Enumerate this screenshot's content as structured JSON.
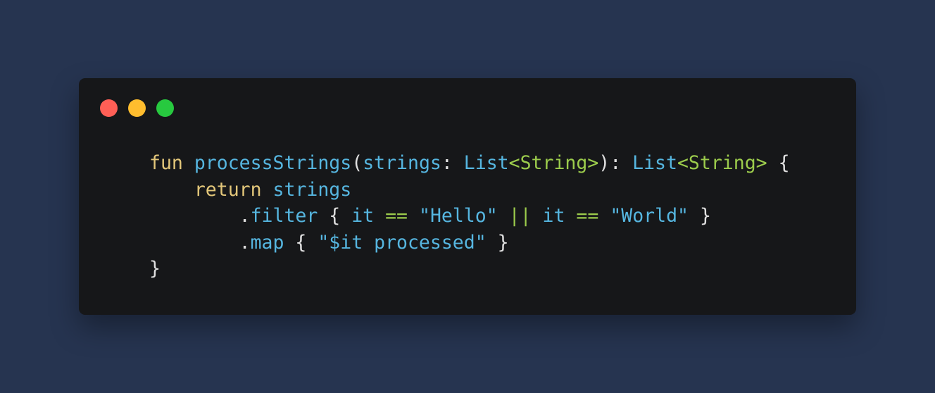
{
  "window": {
    "controls": {
      "close_color": "#ff5f56",
      "minimize_color": "#ffbd2e",
      "zoom_color": "#27c93f"
    }
  },
  "code": {
    "language": "kotlin",
    "lines": [
      [
        {
          "text": "fun",
          "kind": "keyword"
        },
        {
          "text": " ",
          "kind": "punct"
        },
        {
          "text": "processStrings",
          "kind": "fn"
        },
        {
          "text": "(",
          "kind": "punct"
        },
        {
          "text": "strings",
          "kind": "param"
        },
        {
          "text": ": ",
          "kind": "punct"
        },
        {
          "text": "List",
          "kind": "type"
        },
        {
          "text": "<String>",
          "kind": "generic"
        },
        {
          "text": "): ",
          "kind": "punct"
        },
        {
          "text": "List",
          "kind": "type"
        },
        {
          "text": "<String>",
          "kind": "generic"
        },
        {
          "text": " {",
          "kind": "punct"
        }
      ],
      [
        {
          "text": "    ",
          "kind": "punct"
        },
        {
          "text": "return",
          "kind": "keyword"
        },
        {
          "text": " ",
          "kind": "punct"
        },
        {
          "text": "strings",
          "kind": "param"
        }
      ],
      [
        {
          "text": "        .",
          "kind": "punct"
        },
        {
          "text": "filter",
          "kind": "fn"
        },
        {
          "text": " { ",
          "kind": "punct"
        },
        {
          "text": "it",
          "kind": "param"
        },
        {
          "text": " ",
          "kind": "punct"
        },
        {
          "text": "==",
          "kind": "op"
        },
        {
          "text": " ",
          "kind": "punct"
        },
        {
          "text": "\"Hello\"",
          "kind": "string"
        },
        {
          "text": " ",
          "kind": "punct"
        },
        {
          "text": "||",
          "kind": "op"
        },
        {
          "text": " ",
          "kind": "punct"
        },
        {
          "text": "it",
          "kind": "param"
        },
        {
          "text": " ",
          "kind": "punct"
        },
        {
          "text": "==",
          "kind": "op"
        },
        {
          "text": " ",
          "kind": "punct"
        },
        {
          "text": "\"World\"",
          "kind": "string"
        },
        {
          "text": " }",
          "kind": "punct"
        }
      ],
      [
        {
          "text": "        .",
          "kind": "punct"
        },
        {
          "text": "map",
          "kind": "fn"
        },
        {
          "text": " { ",
          "kind": "punct"
        },
        {
          "text": "\"$it processed\"",
          "kind": "string"
        },
        {
          "text": " }",
          "kind": "punct"
        }
      ],
      [
        {
          "text": "}",
          "kind": "punct"
        }
      ]
    ]
  }
}
